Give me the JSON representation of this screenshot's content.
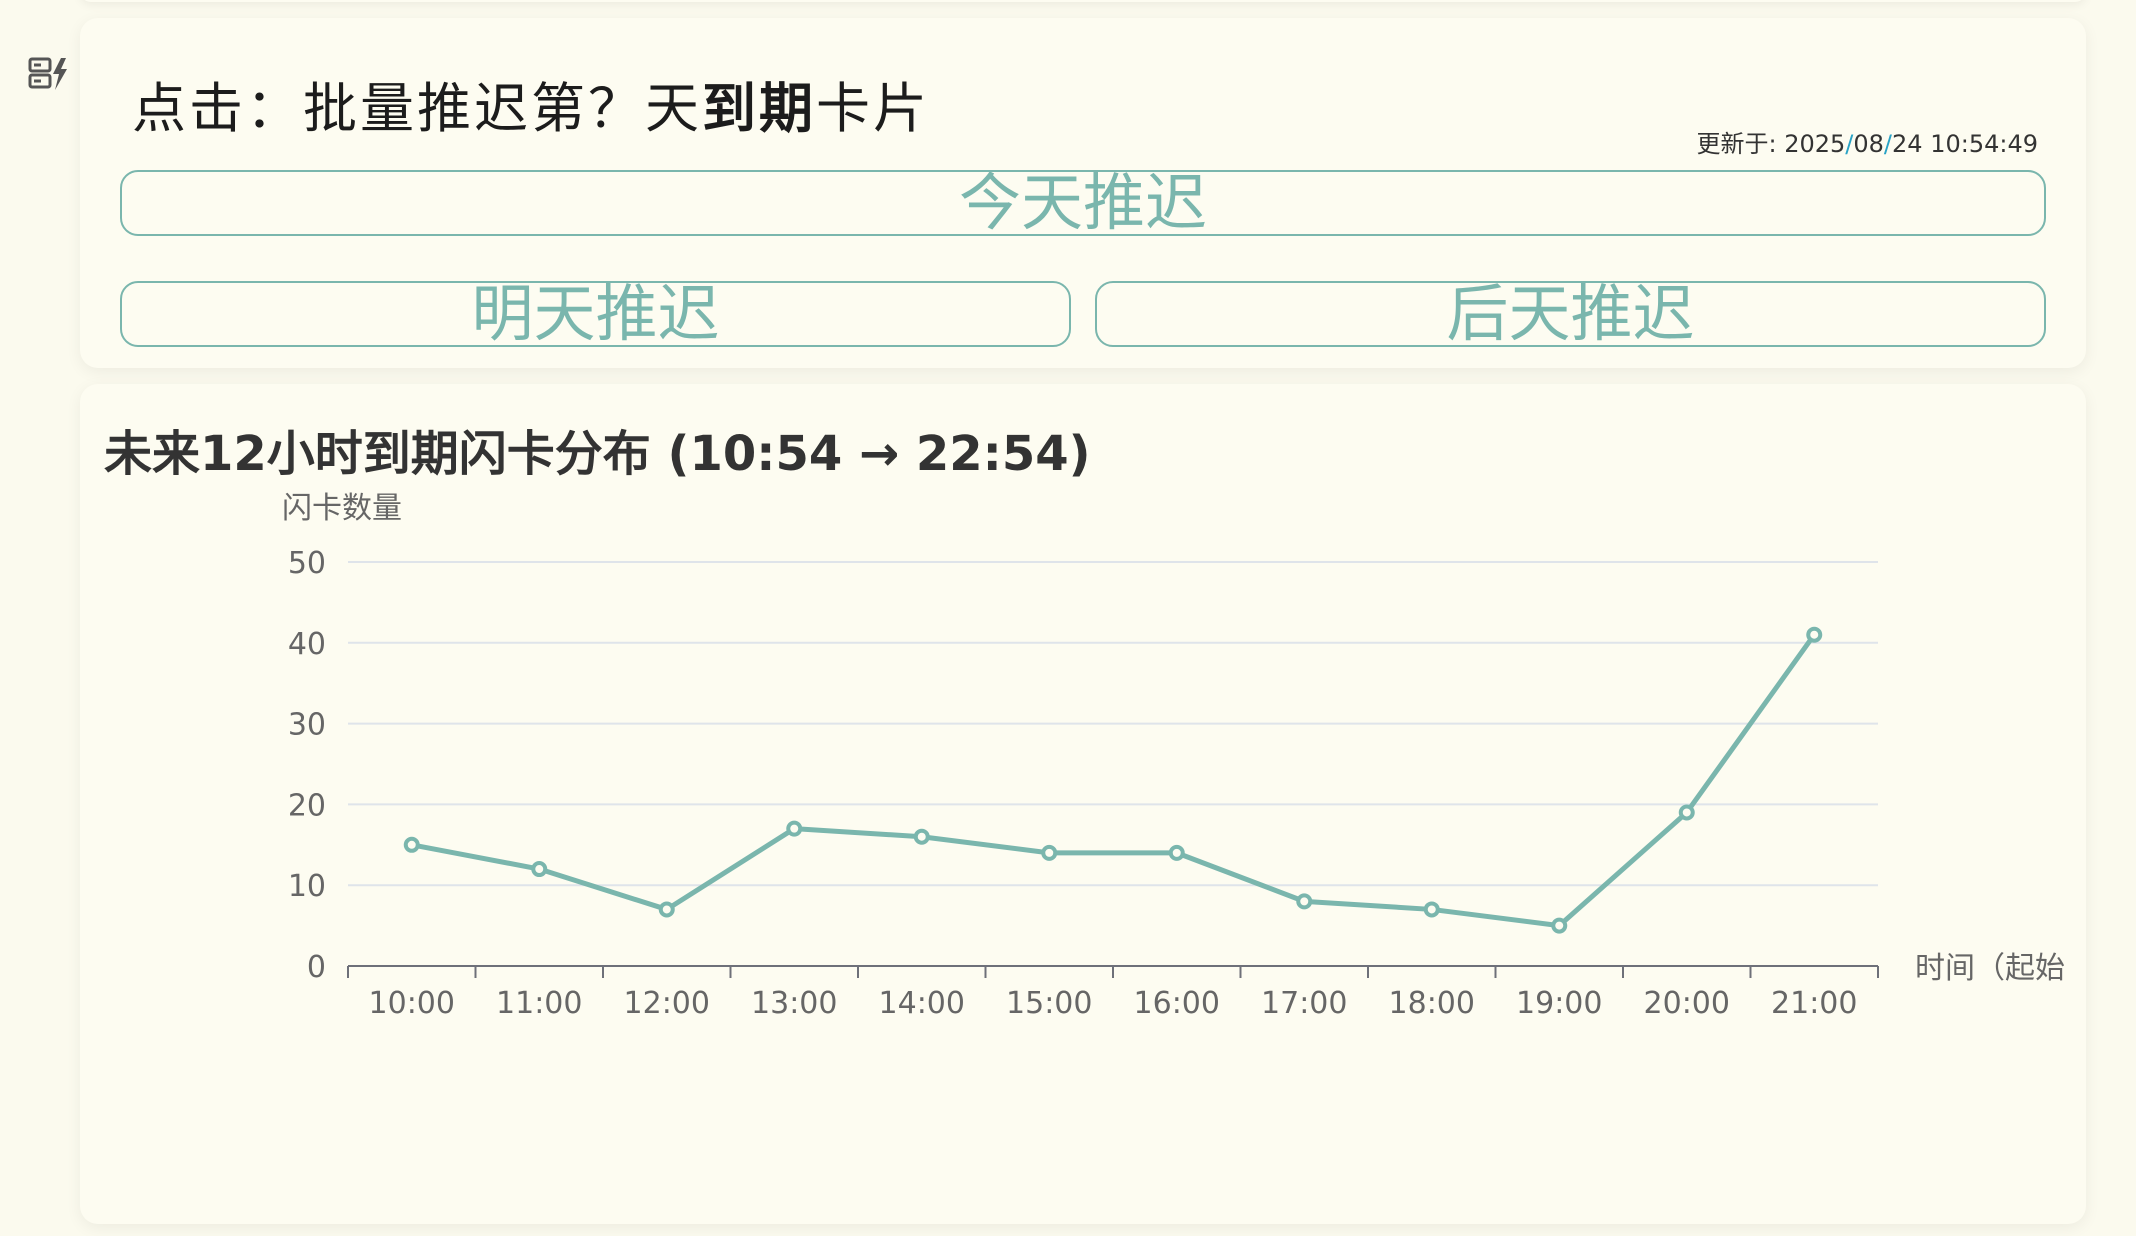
{
  "sidebar": {
    "icon": "flash-card-icon"
  },
  "batch_card": {
    "title_prefix": "点击：批量推迟第？天",
    "title_bold": "到期",
    "title_suffix": "卡片",
    "update_label": "更新于:",
    "update_year": "2025",
    "update_month": "08",
    "update_day": "24",
    "update_time": "10:54:49",
    "buttons": {
      "today": "今天推迟",
      "tomorrow": "明天推迟",
      "day_after": "后天推迟"
    }
  },
  "chart_card": {
    "title": "未来12小时到期闪卡分布 (10:54 → 22:54)"
  },
  "chart_data": {
    "type": "line",
    "categories": [
      "10:00",
      "11:00",
      "12:00",
      "13:00",
      "14:00",
      "15:00",
      "16:00",
      "17:00",
      "18:00",
      "19:00",
      "20:00",
      "21:00"
    ],
    "series": [
      {
        "values": [
          15,
          12,
          7,
          17,
          16,
          14,
          14,
          8,
          7,
          5,
          19,
          41
        ]
      }
    ],
    "ylabel": "闪卡数量",
    "xlabel": "时间（起始",
    "ylim": [
      0,
      50
    ],
    "yticks": [
      0,
      10,
      20,
      30,
      40,
      50
    ],
    "grid": true,
    "color": "#7ab6ad"
  }
}
